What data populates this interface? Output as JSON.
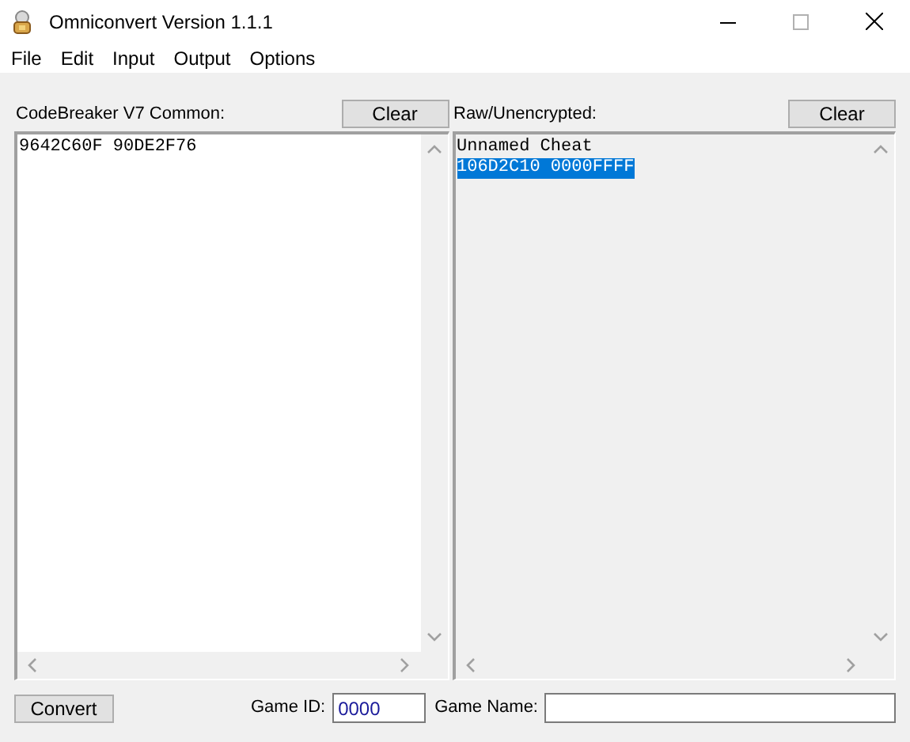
{
  "window": {
    "title": "Omniconvert Version 1.1.1"
  },
  "menu": [
    "File",
    "Edit",
    "Input",
    "Output",
    "Options"
  ],
  "panels": [
    {
      "label": "CodeBreaker V7 Common:",
      "clear_button": "Clear",
      "readonly": false,
      "lines": [
        {
          "text": "9642C60F 90DE2F76",
          "selected": false
        }
      ]
    },
    {
      "label": "Raw/Unencrypted:",
      "clear_button": "Clear",
      "readonly": true,
      "lines": [
        {
          "text": "Unnamed Cheat",
          "selected": false
        },
        {
          "text": "106D2C10 0000FFFF",
          "selected": true
        }
      ]
    }
  ],
  "convert_button": "Convert",
  "game_id": {
    "label": "Game ID:",
    "value": "0000"
  },
  "game_name": {
    "label": "Game Name:"
  }
}
